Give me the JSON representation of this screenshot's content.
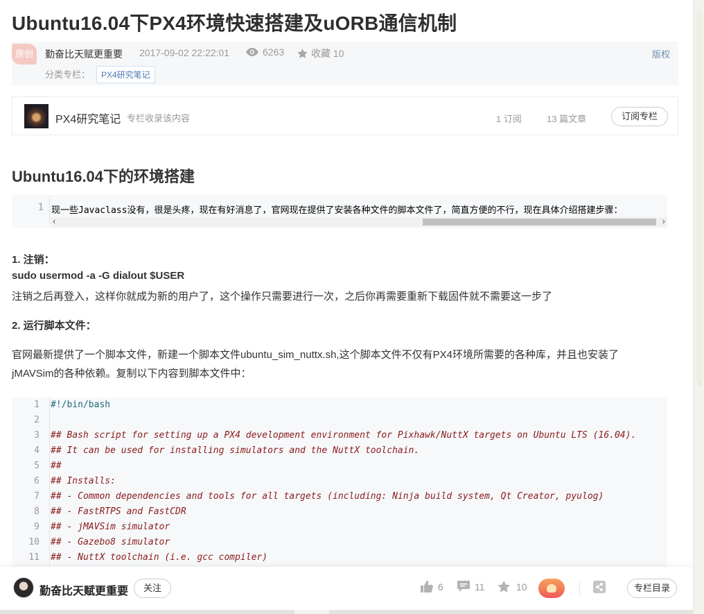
{
  "article": {
    "title": "Ubuntu16.04下PX4环境快速搭建及uORB通信机制",
    "badge": "原创",
    "author": "勤奋比天赋更重要",
    "date": "2017-09-02 22:22:01",
    "views": "6263",
    "favorite_label": "收藏 10",
    "copyright": "版权",
    "category_label": "分类专栏：",
    "category_tag": "PX4研究笔记"
  },
  "column": {
    "name": "PX4研究笔记",
    "desc": "专栏收录该内容",
    "subscriptions": "1 订阅",
    "articles": "13 篇文章",
    "subscribe_button": "订阅专栏"
  },
  "content": {
    "heading": "Ubuntu16.04下的环境搭建",
    "code_block_1": {
      "line_no": "1",
      "text": "现一些Javaclass没有，很是头疼，现在有好消息了，官网现在提供了安装各种文件的脚本文件了，简直方便的不行，现在具体介绍搭建步骤："
    },
    "step1_title": "1. 注销：",
    "step1_cmd": "sudo usermod -a -G dialout $USER",
    "step1_desc": "注销之后再登入，这样你就成为新的用户了，这个操作只需要进行一次，之后你再需要重新下载固件就不需要这一步了",
    "step2_title": "2. 运行脚本文件：",
    "step2_desc_line1": "官网最新提供了一个脚本文件，新建一个脚本文件ubuntu_sim_nuttx.sh,这个脚本文件不仅有PX4环境所需要的各种库，并且也安装了",
    "step2_desc_line2": "jMAVSim的各种依赖。复制以下内容到脚本文件中：",
    "code_block_2": [
      {
        "n": "1",
        "text": "#!/bin/bash",
        "kind": "shebang"
      },
      {
        "n": "2",
        "text": "",
        "kind": "comment"
      },
      {
        "n": "3",
        "text": "## Bash script for setting up a PX4 development environment for Pixhawk/NuttX targets on Ubuntu LTS (16.04).",
        "kind": "comment"
      },
      {
        "n": "4",
        "text": "## It can be used for installing simulators and the NuttX toolchain.",
        "kind": "comment"
      },
      {
        "n": "5",
        "text": "##",
        "kind": "comment"
      },
      {
        "n": "6",
        "text": "## Installs:",
        "kind": "comment"
      },
      {
        "n": "7",
        "text": "## - Common dependencies and tools for all targets (including: Ninja build system, Qt Creator, pyulog)",
        "kind": "comment"
      },
      {
        "n": "8",
        "text": "## - FastRTPS and FastCDR",
        "kind": "comment"
      },
      {
        "n": "9",
        "text": "## - jMAVSim simulator",
        "kind": "comment"
      },
      {
        "n": "10",
        "text": "## - Gazebo8 simulator",
        "kind": "comment"
      },
      {
        "n": "11",
        "text": "## - NuttX toolchain (i.e. gcc compiler)",
        "kind": "comment"
      }
    ]
  },
  "footer": {
    "author": "勤奋比天赋更重要",
    "follow_button": "关注",
    "likes": "6",
    "comments": "11",
    "favorites": "10",
    "toc_button": "专栏目录"
  },
  "icons": {
    "views": "eye-icon",
    "favorite": "star-icon",
    "like": "thumbs-up-icon",
    "comment": "comment-icon",
    "collect": "star-plus-icon",
    "share": "share-icon"
  },
  "colors": {
    "badge": "#f4c9c2",
    "tag_text": "#4d7ab3",
    "code_comment": "#8b1a1a",
    "code_shebang": "#1f6b7b",
    "code_bg": "#f6f8fa"
  }
}
